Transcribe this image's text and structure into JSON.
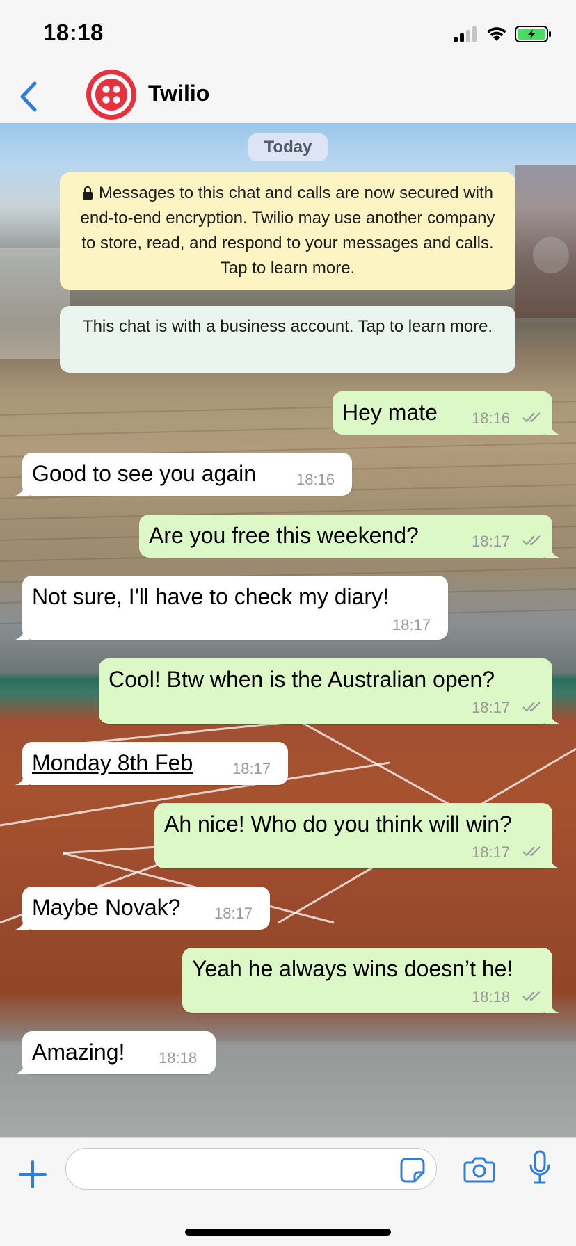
{
  "status_bar": {
    "time": "18:18"
  },
  "header": {
    "contact_name": "Twilio"
  },
  "chat": {
    "date_label": "Today",
    "encryption_notice": "Messages to this chat and calls are now secured with end-to-end encryption. Twilio may use another company to store, read, and respond to your messages and calls. Tap to learn more.",
    "business_notice": "This chat is with a business account. Tap to learn more.",
    "messages": [
      {
        "direction": "out",
        "text": "Hey mate",
        "time": "18:16"
      },
      {
        "direction": "in",
        "text": "Good to see you again",
        "time": "18:16"
      },
      {
        "direction": "out",
        "text": "Are you free this weekend?",
        "time": "18:17"
      },
      {
        "direction": "in",
        "text": "Not sure, I'll have to check my diary!",
        "time": "18:17"
      },
      {
        "direction": "out",
        "text": "Cool! Btw when is the Australian open?",
        "time": "18:17"
      },
      {
        "direction": "in",
        "text": "Monday 8th Feb",
        "time": "18:17"
      },
      {
        "direction": "out",
        "text": "Ah nice! Who do you think will win?",
        "time": "18:17"
      },
      {
        "direction": "in",
        "text": "Maybe Novak?",
        "time": "18:17"
      },
      {
        "direction": "out",
        "text": "Yeah he always wins doesn’t he!",
        "time": "18:18"
      },
      {
        "direction": "in",
        "text": "Amazing!",
        "time": "18:18"
      }
    ]
  },
  "input_bar": {
    "message_value": ""
  },
  "colors": {
    "accent": "#2f7de1",
    "outgoing_bubble": "#dcf8c6",
    "incoming_bubble": "#ffffff",
    "twilio_red": "#e8313f",
    "read_ticks": "#9a9a9a"
  },
  "icons": [
    "back-chevron-icon",
    "twilio-logo-icon",
    "lock-icon",
    "double-check-icon",
    "plus-icon",
    "sticker-icon",
    "camera-icon",
    "microphone-icon",
    "signal-icon",
    "wifi-icon",
    "battery-icon"
  ]
}
